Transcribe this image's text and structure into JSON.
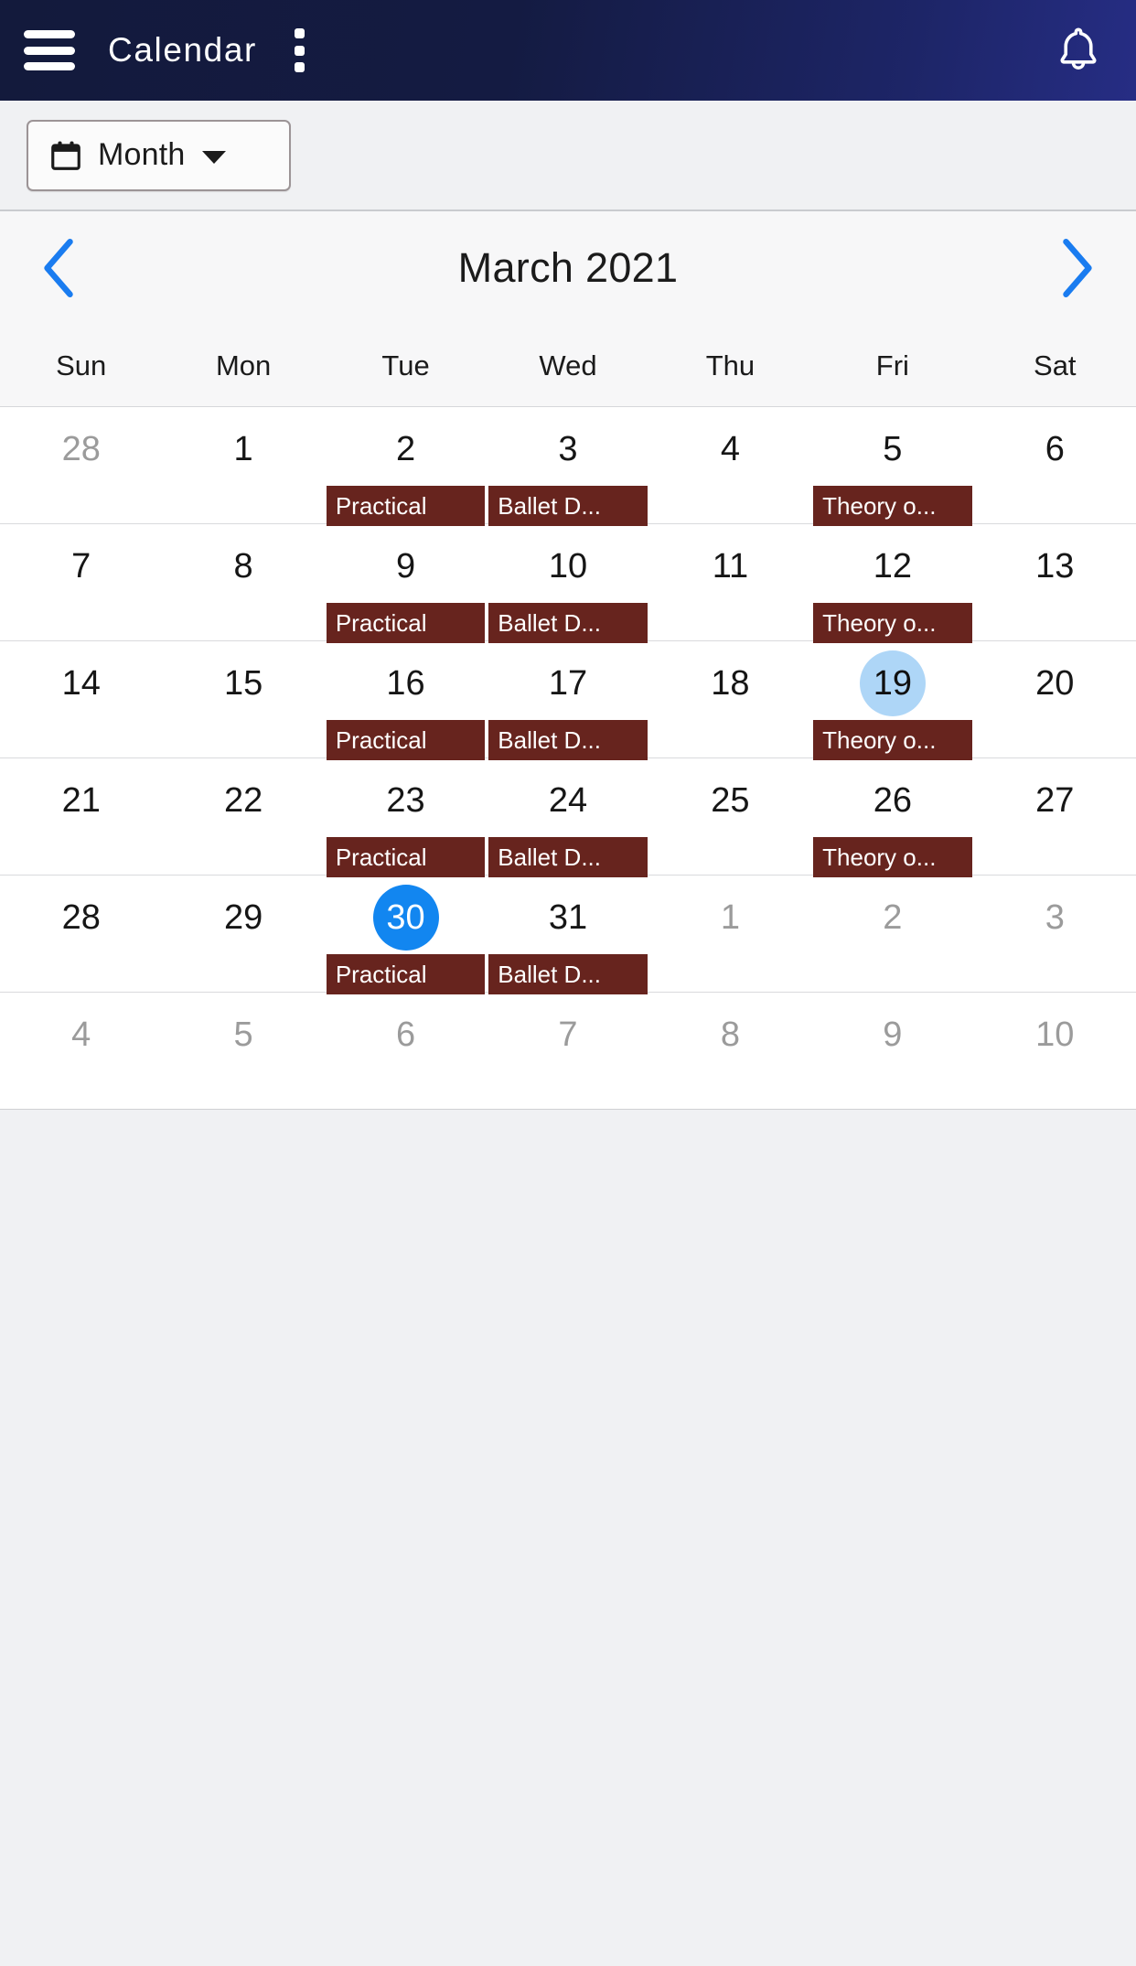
{
  "appbar": {
    "menu_icon": "hamburger-menu-icon",
    "title": "Calendar",
    "overflow_icon": "kebab-menu-icon",
    "notification_icon": "bell-icon",
    "background_start": "#131a3c",
    "background_end": "#262d84"
  },
  "toolbar": {
    "view_icon": "calendar-icon",
    "view_label": "Month",
    "caret_icon": "chevron-down-icon"
  },
  "calendar": {
    "prev_icon": "chevron-left-icon",
    "next_icon": "chevron-right-icon",
    "title": "March 2021",
    "weekdays": [
      "Sun",
      "Mon",
      "Tue",
      "Wed",
      "Thu",
      "Fri",
      "Sat"
    ],
    "event_color": "#67241e",
    "today_color": "#aed6f7",
    "selected_color": "#1286f0",
    "weeks": [
      [
        {
          "label": "28",
          "muted": true,
          "state": "none",
          "event": ""
        },
        {
          "label": "1",
          "muted": false,
          "state": "none",
          "event": ""
        },
        {
          "label": "2",
          "muted": false,
          "state": "none",
          "event": "Practical"
        },
        {
          "label": "3",
          "muted": false,
          "state": "none",
          "event": "Ballet D..."
        },
        {
          "label": "4",
          "muted": false,
          "state": "none",
          "event": ""
        },
        {
          "label": "5",
          "muted": false,
          "state": "none",
          "event": "Theory o..."
        },
        {
          "label": "6",
          "muted": false,
          "state": "none",
          "event": ""
        }
      ],
      [
        {
          "label": "7",
          "muted": false,
          "state": "none",
          "event": ""
        },
        {
          "label": "8",
          "muted": false,
          "state": "none",
          "event": ""
        },
        {
          "label": "9",
          "muted": false,
          "state": "none",
          "event": "Practical"
        },
        {
          "label": "10",
          "muted": false,
          "state": "none",
          "event": "Ballet D..."
        },
        {
          "label": "11",
          "muted": false,
          "state": "none",
          "event": ""
        },
        {
          "label": "12",
          "muted": false,
          "state": "none",
          "event": "Theory o..."
        },
        {
          "label": "13",
          "muted": false,
          "state": "none",
          "event": ""
        }
      ],
      [
        {
          "label": "14",
          "muted": false,
          "state": "none",
          "event": ""
        },
        {
          "label": "15",
          "muted": false,
          "state": "none",
          "event": ""
        },
        {
          "label": "16",
          "muted": false,
          "state": "none",
          "event": "Practical"
        },
        {
          "label": "17",
          "muted": false,
          "state": "none",
          "event": "Ballet D..."
        },
        {
          "label": "18",
          "muted": false,
          "state": "none",
          "event": ""
        },
        {
          "label": "19",
          "muted": false,
          "state": "today",
          "event": "Theory o..."
        },
        {
          "label": "20",
          "muted": false,
          "state": "none",
          "event": ""
        }
      ],
      [
        {
          "label": "21",
          "muted": false,
          "state": "none",
          "event": ""
        },
        {
          "label": "22",
          "muted": false,
          "state": "none",
          "event": ""
        },
        {
          "label": "23",
          "muted": false,
          "state": "none",
          "event": "Practical"
        },
        {
          "label": "24",
          "muted": false,
          "state": "none",
          "event": "Ballet D..."
        },
        {
          "label": "25",
          "muted": false,
          "state": "none",
          "event": ""
        },
        {
          "label": "26",
          "muted": false,
          "state": "none",
          "event": "Theory o..."
        },
        {
          "label": "27",
          "muted": false,
          "state": "none",
          "event": ""
        }
      ],
      [
        {
          "label": "28",
          "muted": false,
          "state": "none",
          "event": ""
        },
        {
          "label": "29",
          "muted": false,
          "state": "none",
          "event": ""
        },
        {
          "label": "30",
          "muted": false,
          "state": "selected",
          "event": "Practical"
        },
        {
          "label": "31",
          "muted": false,
          "state": "none",
          "event": "Ballet D..."
        },
        {
          "label": "1",
          "muted": true,
          "state": "none",
          "event": ""
        },
        {
          "label": "2",
          "muted": true,
          "state": "none",
          "event": ""
        },
        {
          "label": "3",
          "muted": true,
          "state": "none",
          "event": ""
        }
      ],
      [
        {
          "label": "4",
          "muted": true,
          "state": "none",
          "event": ""
        },
        {
          "label": "5",
          "muted": true,
          "state": "none",
          "event": ""
        },
        {
          "label": "6",
          "muted": true,
          "state": "none",
          "event": ""
        },
        {
          "label": "7",
          "muted": true,
          "state": "none",
          "event": ""
        },
        {
          "label": "8",
          "muted": true,
          "state": "none",
          "event": ""
        },
        {
          "label": "9",
          "muted": true,
          "state": "none",
          "event": ""
        },
        {
          "label": "10",
          "muted": true,
          "state": "none",
          "event": ""
        }
      ]
    ]
  }
}
